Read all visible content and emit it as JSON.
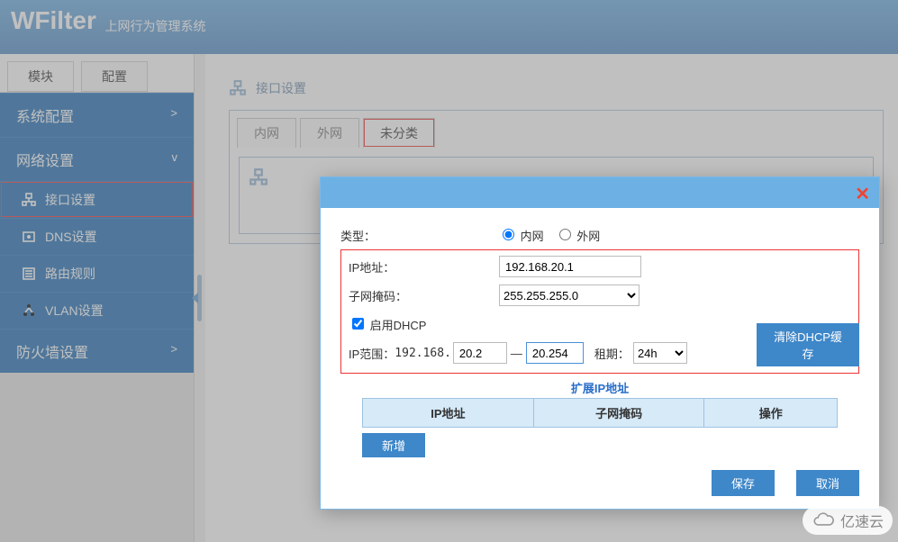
{
  "header": {
    "logo": "WFilter",
    "subtitle": "上网行为管理系统"
  },
  "sidebar": {
    "tabs": [
      "模块",
      "配置"
    ],
    "groups": [
      {
        "label": "系统配置",
        "expanded": false,
        "chevron": ">"
      },
      {
        "label": "网络设置",
        "expanded": true,
        "chevron": "v",
        "items": [
          {
            "label": "接口设置",
            "icon": "network",
            "hl": true
          },
          {
            "label": "DNS设置",
            "icon": "disk"
          },
          {
            "label": "路由规则",
            "icon": "list"
          },
          {
            "label": "VLAN设置",
            "icon": "fork"
          }
        ]
      },
      {
        "label": "防火墙设置",
        "expanded": false,
        "chevron": ">"
      }
    ]
  },
  "main": {
    "breadcrumb": "接口设置",
    "tabs": [
      {
        "label": "内网",
        "active": false
      },
      {
        "label": "外网",
        "active": false
      },
      {
        "label": "未分类",
        "active": true,
        "hl": true
      }
    ]
  },
  "modal": {
    "type_label": "类型：",
    "type_options": [
      {
        "label": "内网",
        "checked": true
      },
      {
        "label": "外网",
        "checked": false
      }
    ],
    "ip_label": "IP地址：",
    "ip_value": "192.168.20.1",
    "mask_label": "子网掩码：",
    "mask_value": "255.255.255.0",
    "dhcp_enable_label": "启用DHCP",
    "dhcp_checked": true,
    "range_label": "IP范围：",
    "range_prefix": "192.168.",
    "range_start": "20.2",
    "range_sep": "—",
    "range_end": "20.254",
    "lease_label": "租期：",
    "lease_value": "24h",
    "clear_cache_btn": "清除DHCP缓存",
    "ext_title": "扩展IP地址",
    "ext_cols": [
      "IP地址",
      "子网掩码",
      "操作"
    ],
    "add_btn": "新增",
    "save_btn": "保存",
    "cancel_btn": "取消"
  },
  "watermark": "亿速云"
}
